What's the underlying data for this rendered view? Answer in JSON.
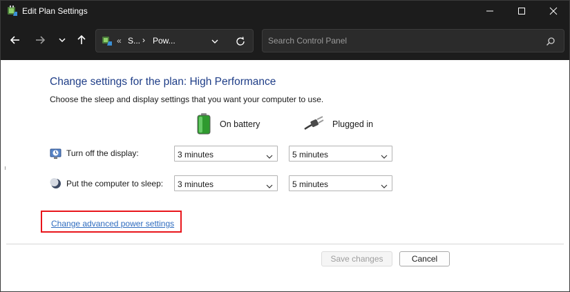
{
  "window": {
    "title": "Edit Plan Settings",
    "controls": {
      "minimize": "minimize-icon",
      "maximize": "maximize-icon",
      "close": "close-icon"
    }
  },
  "nav": {
    "back_icon": "arrow-left-icon",
    "forward_icon": "arrow-right-icon",
    "recent_icon": "chevron-down-icon",
    "up_icon": "arrow-up-icon",
    "address": {
      "separator_root": "«",
      "crumbs": [
        "S...",
        "Pow..."
      ],
      "separator": "›"
    },
    "search_placeholder": "Search Control Panel"
  },
  "content": {
    "heading": "Change settings for the plan: High Performance",
    "subheading": "Choose the sleep and display settings that you want your computer to use.",
    "columns": [
      {
        "label": "On battery",
        "icon": "battery-icon"
      },
      {
        "label": "Plugged in",
        "icon": "power-plug-icon"
      }
    ],
    "rows": [
      {
        "label": "Turn off the display:",
        "icon": "display-timer-icon",
        "battery_value": "3 minutes",
        "plugged_value": "5 minutes"
      },
      {
        "label": "Put the computer to sleep:",
        "icon": "moon-icon",
        "battery_value": "3 minutes",
        "plugged_value": "5 minutes"
      }
    ],
    "advanced_link": "Change advanced power settings",
    "highlight_color": "#e8141a",
    "heading_color": "#1e3d87",
    "link_color": "#2f6cbf"
  },
  "footer": {
    "save_label": "Save changes",
    "cancel_label": "Cancel"
  }
}
